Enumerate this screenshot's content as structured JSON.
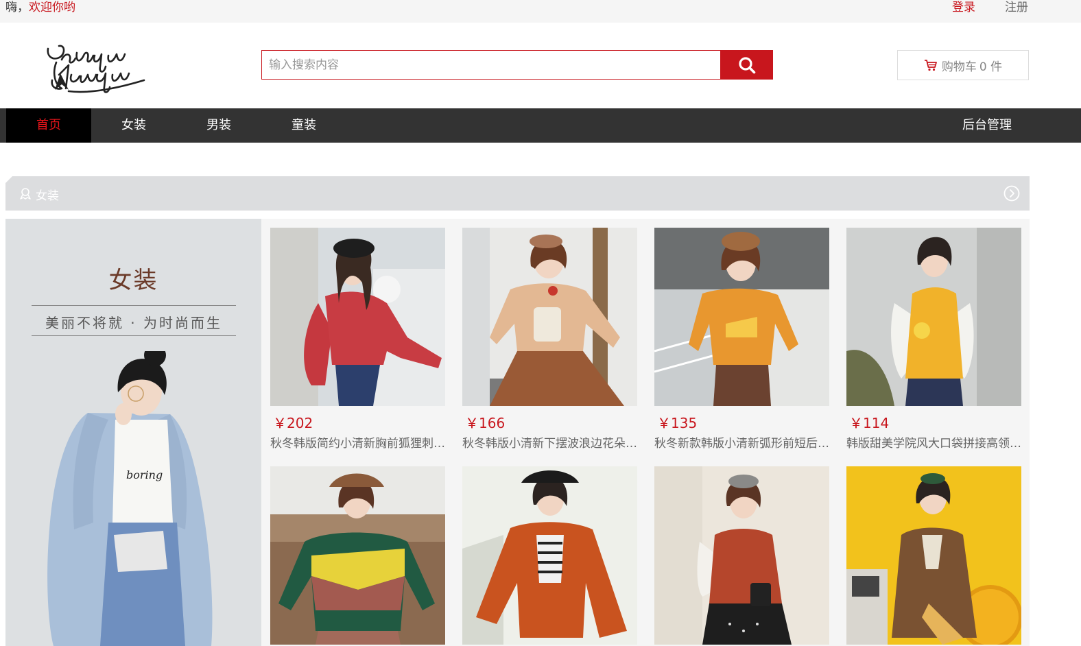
{
  "topbar": {
    "greeting_prefix": "嗨，",
    "greeting_highlight": "欢迎你哟",
    "login": "登录",
    "register": "注册"
  },
  "header": {
    "logo_alt": "Venди Mенди logo",
    "search": {
      "placeholder": "输入搜索内容",
      "value": ""
    },
    "search_icon": "search-icon",
    "cart": {
      "label": "购物车",
      "count": "0 件",
      "icon": "cart-icon"
    }
  },
  "nav": {
    "items": [
      {
        "label": "首页",
        "active": true
      },
      {
        "label": "女装",
        "active": false
      },
      {
        "label": "男装",
        "active": false
      },
      {
        "label": "童装",
        "active": false
      }
    ],
    "admin": "后台管理"
  },
  "section": {
    "title": "女装",
    "icon": "badge-icon",
    "more_icon": "chevron-right-circle-icon"
  },
  "banner": {
    "title": "女装",
    "slogan": "美丽不将就 · 为时尚而生"
  },
  "products": [
    {
      "price": "￥202",
      "name": "秋冬韩版简约小清新胸前狐狸刺绣毛衣"
    },
    {
      "price": "￥166",
      "name": "秋冬韩版小清新下摆波浪边花朵刺绣毛衣"
    },
    {
      "price": "￥135",
      "name": "秋冬新款韩版小清新弧形前短后长毛衣"
    },
    {
      "price": "￥114",
      "name": "韩版甜美学院风大口袋拼接高领马甲"
    },
    {
      "price": "",
      "name": ""
    },
    {
      "price": "",
      "name": ""
    },
    {
      "price": "",
      "name": ""
    },
    {
      "price": "",
      "name": ""
    }
  ],
  "colors": {
    "accent": "#c8161d",
    "nav_bg": "#333333",
    "nav_active_bg": "#000000",
    "nav_active_text": "#e5141a",
    "section_bar": "#dcdddf"
  }
}
